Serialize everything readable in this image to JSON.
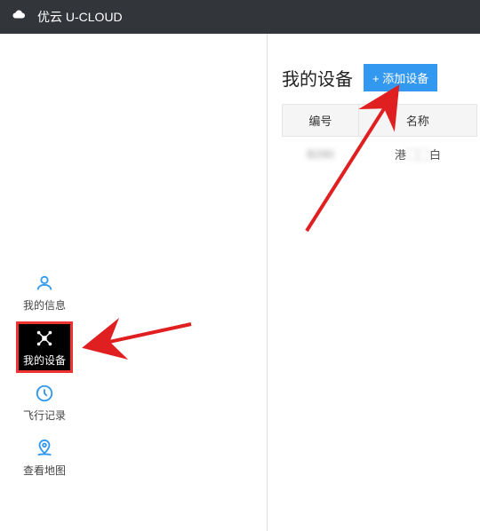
{
  "header": {
    "title": "优云 U-CLOUD"
  },
  "sidebar": {
    "items": [
      {
        "label": "我的信息",
        "active": false
      },
      {
        "label": "我的设备",
        "active": true
      },
      {
        "label": "飞行记录",
        "active": false
      },
      {
        "label": "查看地图",
        "active": false
      }
    ]
  },
  "main": {
    "title": "我的设备",
    "add_button": "+ 添加设备",
    "table": {
      "headers": [
        "编号",
        "名称"
      ],
      "rows": [
        {
          "id": "B290",
          "name_prefix": "港",
          "name_suffix": "白"
        }
      ]
    }
  }
}
